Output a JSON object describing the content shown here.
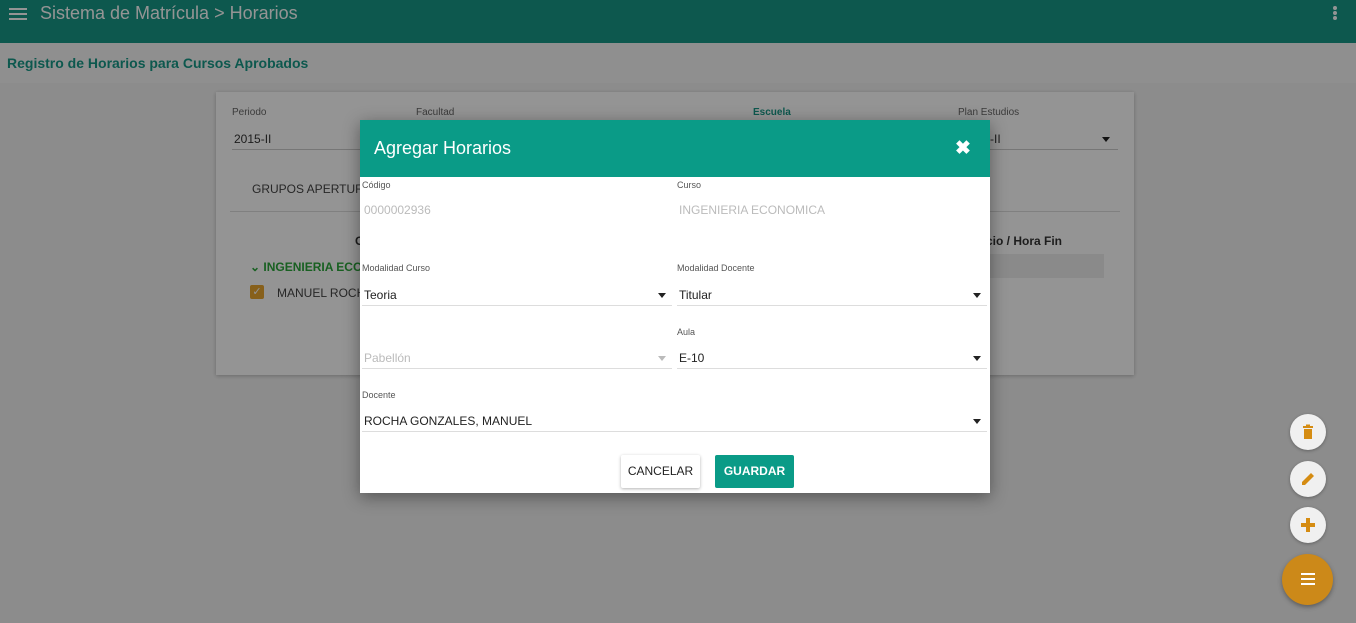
{
  "appbar": {
    "title": "Sistema de Matrícula > Horarios"
  },
  "page": {
    "subtitle": "Registro de Horarios para Cursos Aprobados"
  },
  "card": {
    "periodo_label": "Periodo",
    "periodo_value": "2015-II",
    "facultad_label": "Facultad",
    "escuela_label": "Escuela",
    "plan_label": "Plan Estudios",
    "plan_value_partial": "-II",
    "tab_label": "GRUPOS APERTUR",
    "col_c": "C",
    "col_hora": "cio / Hora Fin",
    "group_label": "INGENIERIA ECO",
    "person_label": "MANUEL ROCH"
  },
  "dialog": {
    "title": "Agregar Horarios",
    "codigo_label": "Código",
    "codigo_value": "0000002936",
    "curso_label": "Curso",
    "curso_value": "INGENIERIA ECONOMICA",
    "mod_curso_label": "Modalidad Curso",
    "mod_curso_value": "Teoria",
    "mod_docente_label": "Modalidad Docente",
    "mod_docente_value": "Titular",
    "pabellon_placeholder": "Pabellón",
    "aula_label": "Aula",
    "aula_value": "E-10",
    "docente_label": "Docente",
    "docente_value": "ROCHA GONZALES, MANUEL",
    "cancel_label": "CANCELAR",
    "save_label": "GUARDAR"
  },
  "fabs": {
    "delete_icon": "trash-icon",
    "edit_icon": "pencil-icon",
    "add_icon": "plus-icon",
    "menu_icon": "menu-icon"
  },
  "colors": {
    "primary": "#179887",
    "accent": "#cc8919"
  }
}
